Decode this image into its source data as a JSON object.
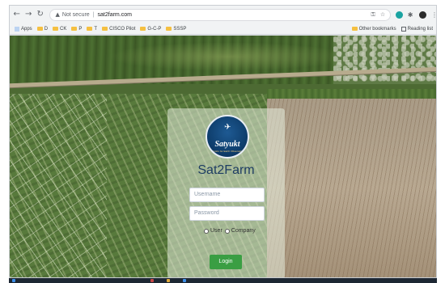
{
  "browser": {
    "security_label": "Not secure",
    "url": "sat2farm.com",
    "bookmarks": [
      {
        "label": "Apps"
      },
      {
        "label": "D"
      },
      {
        "label": "CK"
      },
      {
        "label": "P"
      },
      {
        "label": "T"
      },
      {
        "label": "CISCO Pilot"
      },
      {
        "label": "G-C-P"
      },
      {
        "label": "SSSP"
      }
    ],
    "other_bookmarks": "Other bookmarks",
    "reading_list": "Reading list"
  },
  "login_card": {
    "logo_text": "Satyukt",
    "logo_tagline": "Analytics for Earth Observations",
    "title": "Sat2Farm",
    "username_placeholder": "Username",
    "password_placeholder": "Password",
    "role_options": [
      "User",
      "Company"
    ],
    "login_label": "Login"
  },
  "colors": {
    "card_title": "#1e3d63",
    "login_button": "#3a9e43"
  }
}
